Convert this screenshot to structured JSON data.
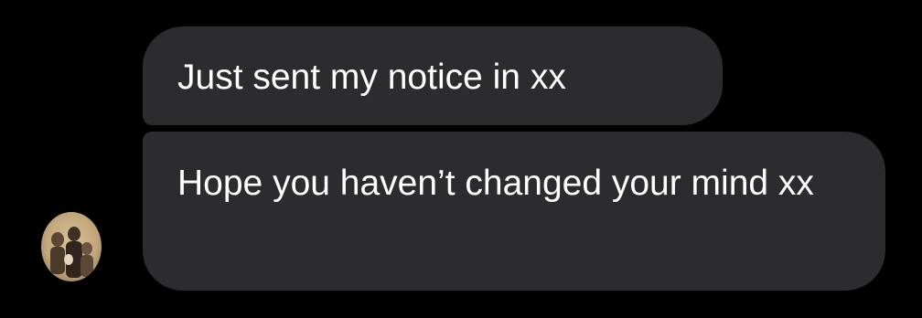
{
  "conversation": {
    "messages": [
      {
        "text": "Just sent my notice in xx"
      },
      {
        "text": "Hope you haven’t changed your mind xx"
      }
    ],
    "avatar": {
      "icon": "sender-photo-avatar"
    }
  },
  "colors": {
    "background": "#000000",
    "bubble": "#2c2c2e",
    "text": "#ffffff",
    "avatar_sepia": "#c8b08a"
  }
}
